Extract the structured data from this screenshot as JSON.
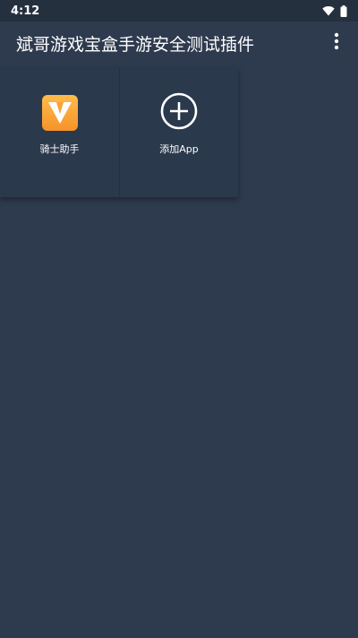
{
  "status_bar": {
    "time": "4:12"
  },
  "app_bar": {
    "title": "斌哥游戏宝盒手游安全测试插件",
    "menu_icon": "more-vert-icon"
  },
  "apps": [
    {
      "label": "骑士助手",
      "icon": "knight-assistant-icon"
    },
    {
      "label": "添加App",
      "icon": "add-circle-icon"
    }
  ],
  "colors": {
    "background": "#2e3a4e",
    "status_bar": "#25303f",
    "tile": "#2b394d",
    "knight_orange": "#f5942a"
  }
}
